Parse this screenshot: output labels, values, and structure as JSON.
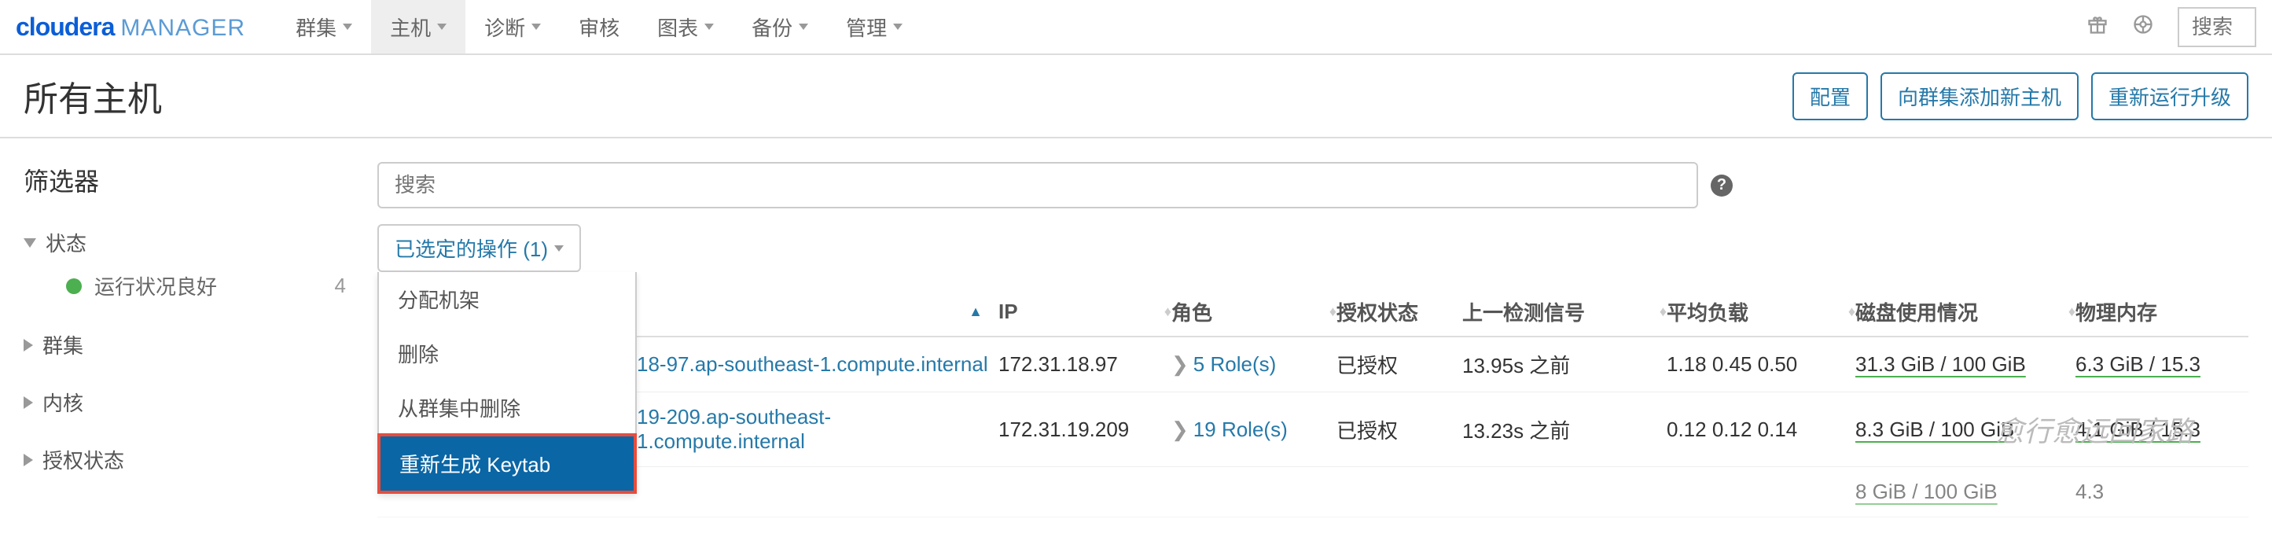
{
  "logo": {
    "brand": "cloudera",
    "product": "MANAGER"
  },
  "nav": {
    "items": [
      {
        "label": "群集",
        "active": false
      },
      {
        "label": "主机",
        "active": true
      },
      {
        "label": "诊断",
        "active": false
      },
      {
        "label": "审核",
        "active": false
      },
      {
        "label": "图表",
        "active": false
      },
      {
        "label": "备份",
        "active": false
      },
      {
        "label": "管理",
        "active": false
      }
    ],
    "search_placeholder": "搜索"
  },
  "page": {
    "title": "所有主机",
    "actions": {
      "configure": "配置",
      "add_hosts": "向群集添加新主机",
      "rerun_upgrade": "重新运行升级"
    }
  },
  "sidebar": {
    "title": "筛选器",
    "groups": {
      "status": {
        "label": "状态",
        "expanded": true,
        "items": [
          {
            "label": "运行状况良好",
            "count": "4"
          }
        ]
      },
      "cluster": {
        "label": "群集",
        "expanded": false
      },
      "kernel": {
        "label": "内核",
        "expanded": false
      },
      "auth": {
        "label": "授权状态",
        "expanded": false
      }
    }
  },
  "main": {
    "search_placeholder": "搜索",
    "selected_actions": {
      "label": "已选定的操作 (1)",
      "menu": {
        "assign_rack": "分配机架",
        "delete": "删除",
        "remove_from_cluster": "从群集中删除",
        "regenerate_keytab": "重新生成 Keytab"
      }
    },
    "columns": {
      "ip": "IP",
      "roles": "角色",
      "auth_status": "授权状态",
      "last_heartbeat": "上一检测信号",
      "load_avg": "平均负载",
      "disk_usage": "磁盘使用情况",
      "physical_mem": "物理内存"
    },
    "rows": [
      {
        "name": "18-97.ap-southeast-1.compute.internal",
        "ip": "172.31.18.97",
        "roles": "5 Role(s)",
        "auth": "已授权",
        "heartbeat": "13.95s 之前",
        "load": "1.18 0.45 0.50",
        "disk": "31.3 GiB / 100 GiB",
        "mem": "6.3 GiB / 15.3"
      },
      {
        "name": "19-209.ap-southeast-1.compute.internal",
        "ip": "172.31.19.209",
        "roles": "19 Role(s)",
        "auth": "已授权",
        "heartbeat": "13.23s 之前",
        "load": "0.12 0.12 0.14",
        "disk": "8.3 GiB / 100 GiB",
        "mem": "4.1 GiB / 15.3"
      },
      {
        "name": "",
        "ip": "",
        "roles": "",
        "auth": "",
        "heartbeat": "",
        "load": "",
        "disk": "8 GiB / 100 GiB",
        "mem": "4.3"
      }
    ]
  },
  "watermark": "愈行愈远回家路"
}
